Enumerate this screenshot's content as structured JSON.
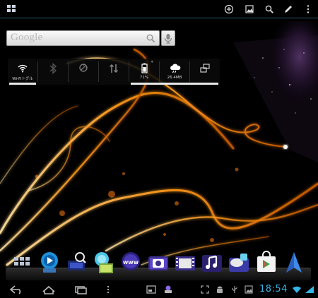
{
  "colors": {
    "accent": "#35b5e5",
    "clock": "#35b5e5",
    "widget_bar": "#e8e8e8"
  },
  "top_bar": {
    "left_icon": "all-apps-grid-icon",
    "actions": [
      "add-icon",
      "wallpaper-icon",
      "search-icon",
      "edit-icon",
      "overflow-menu-icon"
    ]
  },
  "search": {
    "placeholder": "Google",
    "voice_icon": "mic-icon",
    "search_icon": "search-icon"
  },
  "power_widget": {
    "items": [
      {
        "id": "wifi",
        "icon": "wifi-icon",
        "label": "Wi-Fiトグル",
        "active": true
      },
      {
        "id": "bluetooth",
        "icon": "bluetooth-icon",
        "label": "",
        "active": false
      },
      {
        "id": "gps",
        "icon": "gps-icon",
        "label": "",
        "active": false
      },
      {
        "id": "sync",
        "icon": "sync-icon",
        "label": "",
        "active": false
      },
      {
        "id": "battery",
        "icon": "battery-icon",
        "label": "71%",
        "active": true
      },
      {
        "id": "weather",
        "icon": "weather-icon",
        "label": "26.4MB",
        "active": true
      },
      {
        "id": "rotate",
        "icon": "rotate-icon",
        "label": "",
        "active": false
      }
    ]
  },
  "dock": {
    "items": [
      "app-drawer-icon",
      "media-player-icon",
      "network-search-icon",
      "gallery-icon",
      "browser-icon",
      "camera-icon",
      "video-icon",
      "music-icon",
      "messaging-icon",
      "play-store-icon",
      "navigation-icon"
    ],
    "browser_text": "www"
  },
  "system_bar": {
    "nav": [
      "back-icon",
      "home-icon",
      "recent-apps-icon",
      "menu-icon"
    ],
    "status_icons": [
      "screenshot-icon",
      "notification-icon",
      "expand-icon",
      "android-icon",
      "usb-icon",
      "image-icon"
    ],
    "clock": "18:54",
    "signal_icons": [
      "wifi-signal-icon",
      "cell-signal-icon"
    ]
  }
}
